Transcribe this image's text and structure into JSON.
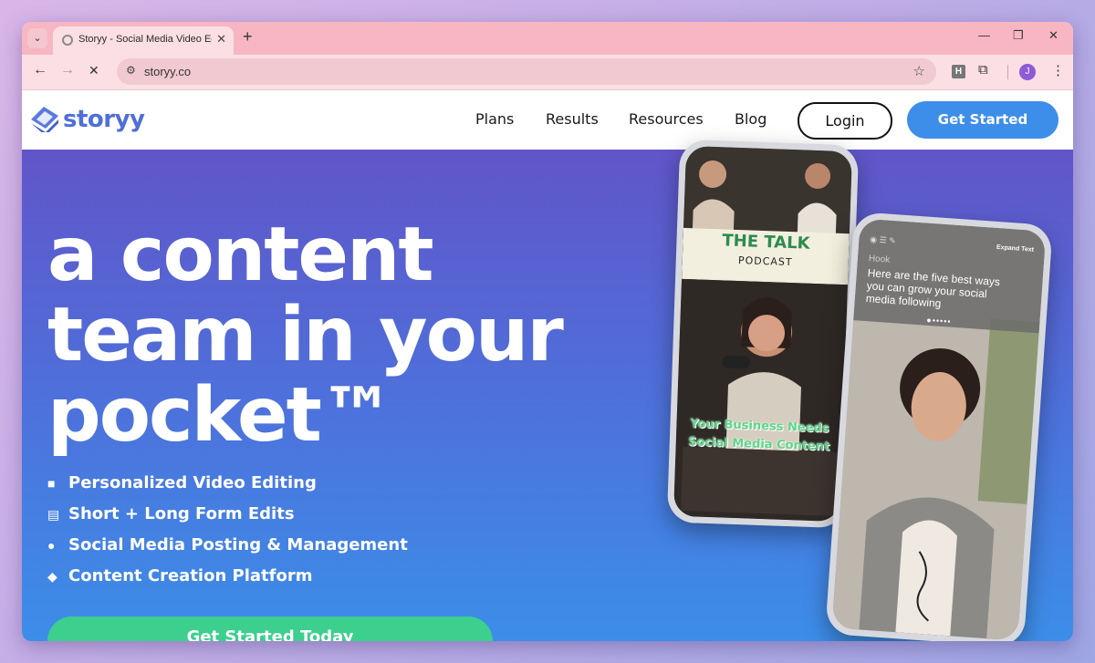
{
  "browser": {
    "tab_title": "Storyy - Social Media Video Editi",
    "url": "storyy.co",
    "profile_initial": "J",
    "extension_label": "H"
  },
  "header": {
    "logo_text": "storyy",
    "nav": [
      "Plans",
      "Results",
      "Resources",
      "Blog"
    ],
    "login_label": "Login",
    "cta_label": "Get Started"
  },
  "hero": {
    "headline_lines": [
      "a content",
      "team in your",
      "pocket™"
    ],
    "features": [
      {
        "icon": "video-camera-icon",
        "text": "Personalized Video Editing"
      },
      {
        "icon": "film-icon",
        "text": "Short + Long Form Edits"
      },
      {
        "icon": "chat-icon",
        "text": "Social Media Posting & Management"
      },
      {
        "icon": "eraser-icon",
        "text": "Content Creation Platform"
      }
    ],
    "cta_label": "Get Started Today"
  },
  "phone_left": {
    "title": "THE TALK",
    "subtitle": "PODCAST",
    "caption_line1": "Your Business Needs",
    "caption_line2": "Social Media Content"
  },
  "phone_right": {
    "toolbar_label": "Expand Text",
    "hook_label": "Hook",
    "hook_text_lines": [
      "Here are the five best ways",
      "you can grow your social",
      "media following"
    ]
  },
  "colors": {
    "brand": "#4f6fd9",
    "cta_blue": "#3d8ee9",
    "cta_green": "#3ccf8e",
    "tab_strip": "#f7b6c2"
  }
}
